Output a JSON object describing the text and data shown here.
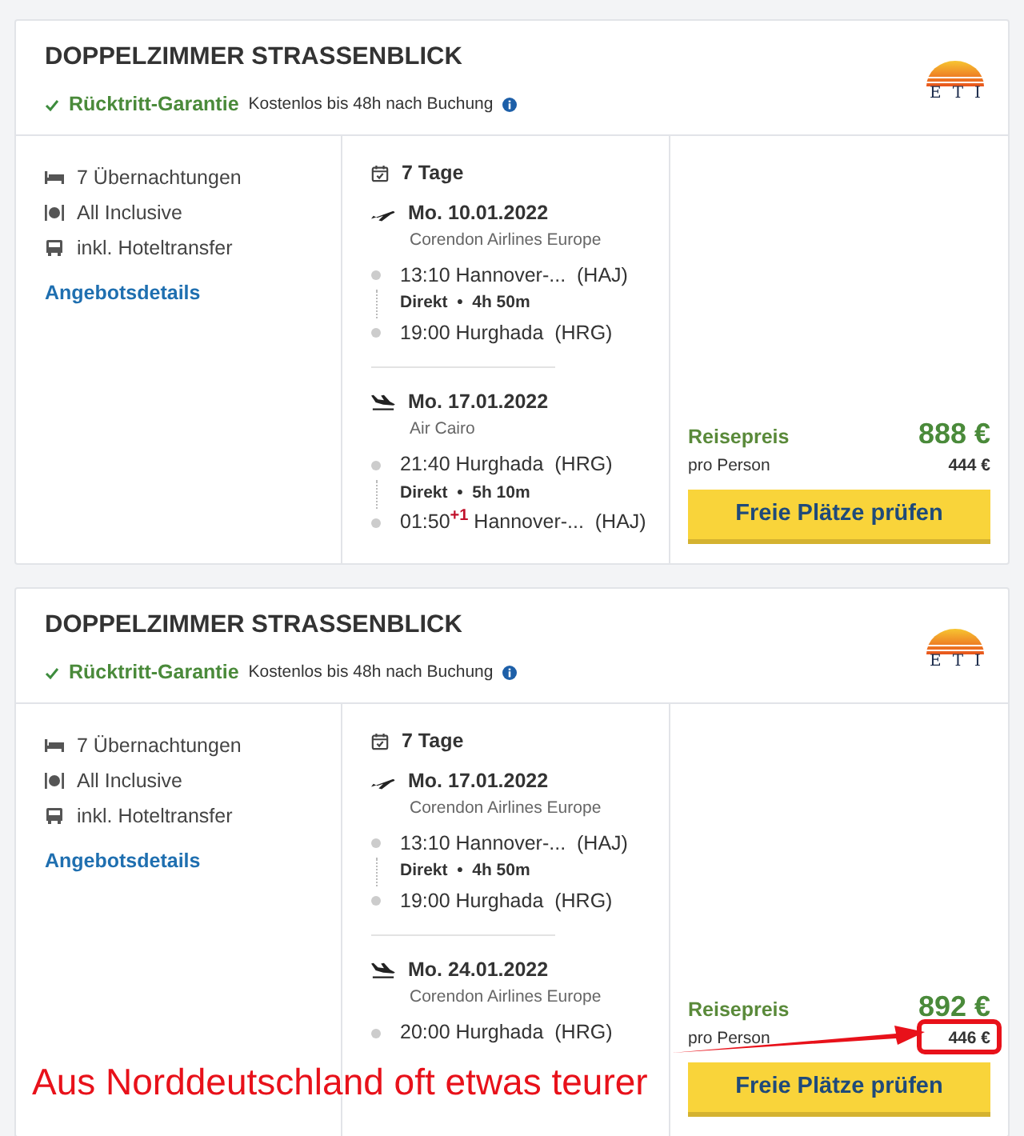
{
  "offers": [
    {
      "title": "DOPPELZIMMER STRASSENBLICK",
      "logo": {
        "text": "ETI"
      },
      "guarantee": {
        "label": "Rücktritt-Garantie",
        "note": "Kostenlos bis 48h nach Buchung"
      },
      "features": [
        {
          "kind": "bed",
          "text": "7 Übernachtungen"
        },
        {
          "kind": "meal",
          "text": "All Inclusive"
        },
        {
          "kind": "bus",
          "text": "inkl. Hoteltransfer"
        }
      ],
      "details_link": "Angebotsdetails",
      "duration": "7 Tage",
      "flights": [
        {
          "kind": "outbound",
          "date": "Mo. 10.01.2022",
          "airline": "Corendon Airlines Europe",
          "departure": {
            "time": "13:10",
            "place": "Hannover-...",
            "code": "(HAJ)"
          },
          "info": {
            "type": "Direkt",
            "separator": "•",
            "duration": "4h 50m"
          },
          "arrival": {
            "time": "19:00",
            "place": "Hurghada",
            "code": "(HRG)"
          }
        },
        {
          "kind": "return",
          "date": "Mo. 17.01.2022",
          "airline": "Air Cairo",
          "departure": {
            "time": "21:40",
            "place": "Hurghada",
            "code": "(HRG)"
          },
          "info": {
            "type": "Direkt",
            "separator": "•",
            "duration": "5h 10m"
          },
          "arrival": {
            "time": "01:50",
            "day_offset": "+1",
            "place": "Hannover-...",
            "code": "(HAJ)"
          }
        }
      ],
      "price": {
        "label": "Reisepreis",
        "total": "888 €",
        "per_person_label": "pro Person",
        "per_person": "444 €"
      },
      "button": "Freie Plätze prüfen"
    },
    {
      "title": "DOPPELZIMMER STRASSENBLICK",
      "logo": {
        "text": "ETI"
      },
      "guarantee": {
        "label": "Rücktritt-Garantie",
        "note": "Kostenlos bis 48h nach Buchung"
      },
      "features": [
        {
          "kind": "bed",
          "text": "7 Übernachtungen"
        },
        {
          "kind": "meal",
          "text": "All Inclusive"
        },
        {
          "kind": "bus",
          "text": "inkl. Hoteltransfer"
        }
      ],
      "details_link": "Angebotsdetails",
      "duration": "7 Tage",
      "flights": [
        {
          "kind": "outbound",
          "date": "Mo. 17.01.2022",
          "airline": "Corendon Airlines Europe",
          "departure": {
            "time": "13:10",
            "place": "Hannover-...",
            "code": "(HAJ)"
          },
          "info": {
            "type": "Direkt",
            "separator": "•",
            "duration": "4h 50m"
          },
          "arrival": {
            "time": "19:00",
            "place": "Hurghada",
            "code": "(HRG)"
          }
        },
        {
          "kind": "return",
          "date": "Mo. 24.01.2022",
          "airline": "Corendon Airlines Europe",
          "departure": {
            "time": "20:00",
            "place": "Hurghada",
            "code": "(HRG)"
          }
        }
      ],
      "price": {
        "label": "Reisepreis",
        "total": "892 €",
        "per_person_label": "pro Person",
        "per_person": "446 €"
      },
      "button": "Freie Plätze prüfen"
    }
  ],
  "annotation": {
    "text": "Aus Norddeutschland oft etwas teurer"
  }
}
